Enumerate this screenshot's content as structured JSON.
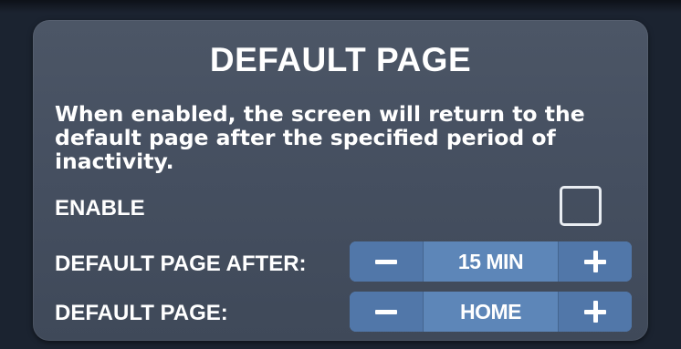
{
  "screen": {
    "title": "DEFAULT PAGE",
    "description": "When enabled, the screen will return to the default page after the specified period of inactivity."
  },
  "enable_row": {
    "label": "ENABLE",
    "checked": false
  },
  "default_page_after_row": {
    "label": "DEFAULT PAGE AFTER:",
    "value": "15 MIN",
    "decrement_icon": "minus-icon",
    "increment_icon": "plus-icon"
  },
  "default_page_row": {
    "label": "DEFAULT PAGE:",
    "value": "HOME",
    "decrement_icon": "minus-icon",
    "increment_icon": "plus-icon"
  },
  "colors": {
    "panel": "#465061",
    "background": "#1b2330",
    "stepper_button": "#5177a9",
    "stepper_value": "#5d86b8",
    "text": "#ffffff"
  }
}
